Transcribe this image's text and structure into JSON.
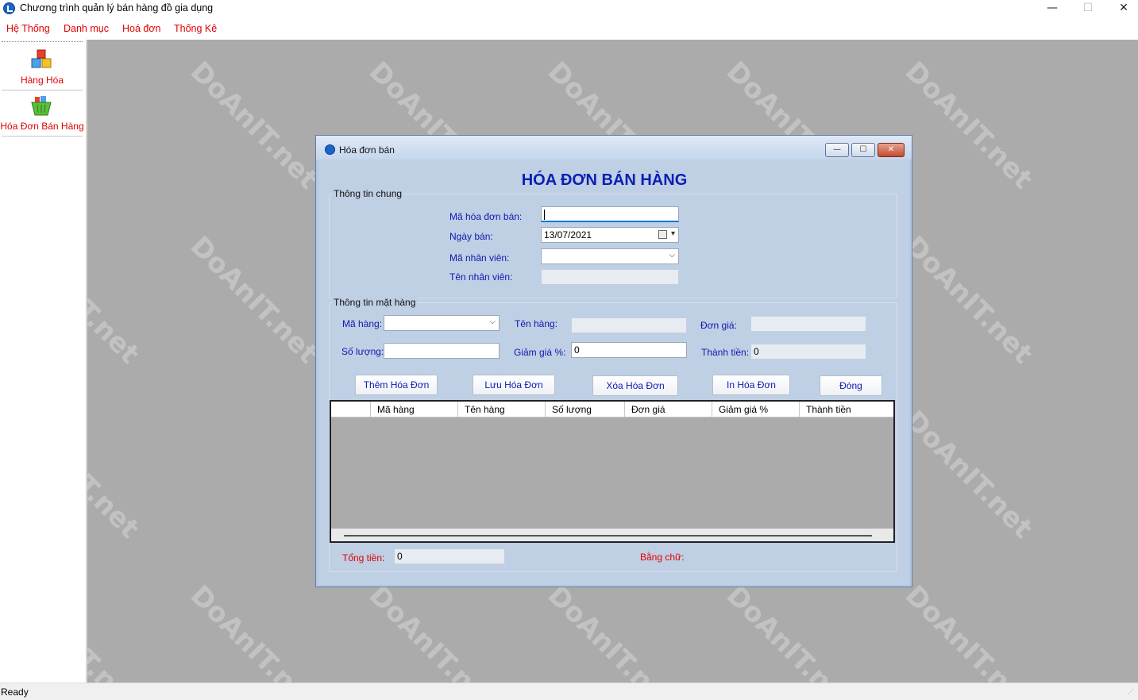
{
  "app": {
    "title": "Chương trình quản lý bán hàng đồ gia dụng",
    "min_glyph": "—",
    "max_glyph": "☐",
    "close_glyph": "✕"
  },
  "menu": [
    "Hệ Thống",
    "Danh mục",
    "Hoá đơn",
    "Thống Kê"
  ],
  "sidebar": [
    {
      "label": "Hàng Hóa",
      "icon": "cubes-icon"
    },
    {
      "label": "Hóa Đơn Bán Hàng",
      "icon": "shopping-basket-icon"
    }
  ],
  "status": "Ready",
  "watermark": "DoAnIT.net",
  "form": {
    "title": "Hóa đơn bán",
    "heading": "HÓA ĐƠN BÁN HÀNG",
    "general_group": "Thông tin chung",
    "invoice_id_label": "Mã hóa đơn bán:",
    "invoice_id_value": "",
    "date_label": "Ngày bán:",
    "date_value": "13/07/2021",
    "employee_id_label": "Mã nhân viên:",
    "employee_id_value": "",
    "employee_name_label": "Tên nhân viên:",
    "employee_name_value": "",
    "item_group": "Thông tin mặt hàng",
    "item_id_label": "Mã hàng:",
    "item_name_label": "Tên hàng:",
    "unit_price_label": "Đơn giá:",
    "quantity_label": "Số lượng:",
    "discount_label": "Giảm giá %:",
    "discount_value": "0",
    "line_total_label": "Thành tiền:",
    "line_total_value": "0",
    "buttons": {
      "add": "Thêm Hóa Đơn",
      "save": "Lưu Hóa Đơn",
      "delete": "Xóa Hóa Đơn",
      "print": "In Hóa Đơn",
      "close": "Đóng"
    },
    "grid_columns": [
      "Mã hàng",
      "Tên hàng",
      "Số lượng",
      "Đơn giá",
      "Giảm giá %",
      "Thành tiền"
    ],
    "total_label": "Tổng tiền:",
    "total_value": "0",
    "in_words_label": "Bằng chữ:"
  }
}
